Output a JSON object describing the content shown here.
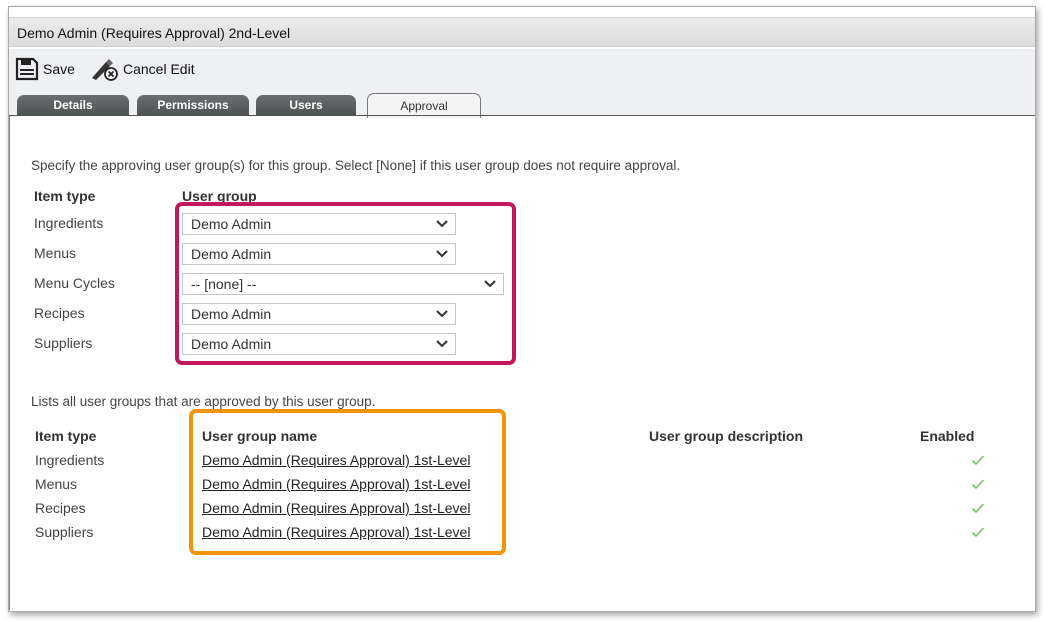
{
  "window": {
    "title": "Demo Admin (Requires Approval) 2nd-Level"
  },
  "toolbar": {
    "save_label": "Save",
    "cancel_label": "Cancel Edit"
  },
  "tabs": [
    {
      "label": "Details",
      "active": false
    },
    {
      "label": "Permissions",
      "active": false
    },
    {
      "label": "Users",
      "active": false
    },
    {
      "label": "Approval",
      "active": true
    }
  ],
  "approval": {
    "instruction": "Specify the approving user group(s) for this group. Select [None] if this user group does not require approval.",
    "col_item_type": "Item type",
    "col_user_group": "User group",
    "rows": [
      {
        "item_type": "Ingredients",
        "user_group": "Demo Admin"
      },
      {
        "item_type": "Menus",
        "user_group": "Demo Admin"
      },
      {
        "item_type": "Menu Cycles",
        "user_group": "-- [none] --"
      },
      {
        "item_type": "Recipes",
        "user_group": "Demo Admin"
      },
      {
        "item_type": "Suppliers",
        "user_group": "Demo Admin"
      }
    ]
  },
  "approved_groups": {
    "caption": "Lists all user groups that are approved by this user group.",
    "columns": {
      "item_type": "Item type",
      "name": "User group name",
      "description": "User group description",
      "enabled": "Enabled"
    },
    "rows": [
      {
        "item_type": "Ingredients",
        "name": "Demo Admin (Requires Approval) 1st-Level",
        "description": "",
        "enabled": true
      },
      {
        "item_type": "Menus",
        "name": "Demo Admin (Requires Approval) 1st-Level",
        "description": "",
        "enabled": true
      },
      {
        "item_type": "Recipes",
        "name": "Demo Admin (Requires Approval) 1st-Level",
        "description": "",
        "enabled": true
      },
      {
        "item_type": "Suppliers",
        "name": "Demo Admin (Requires Approval) 1st-Level",
        "description": "",
        "enabled": true
      }
    ]
  },
  "colors": {
    "highlight_red": "#c0185a",
    "highlight_orange": "#f5930b",
    "tab_dark": "#555a5b",
    "check_green": "#7cc25e"
  },
  "icons": {
    "save": "save-icon",
    "cancel": "cancel-edit-icon",
    "dropdown": "chevron-down-icon",
    "enabled": "checkmark-icon"
  }
}
